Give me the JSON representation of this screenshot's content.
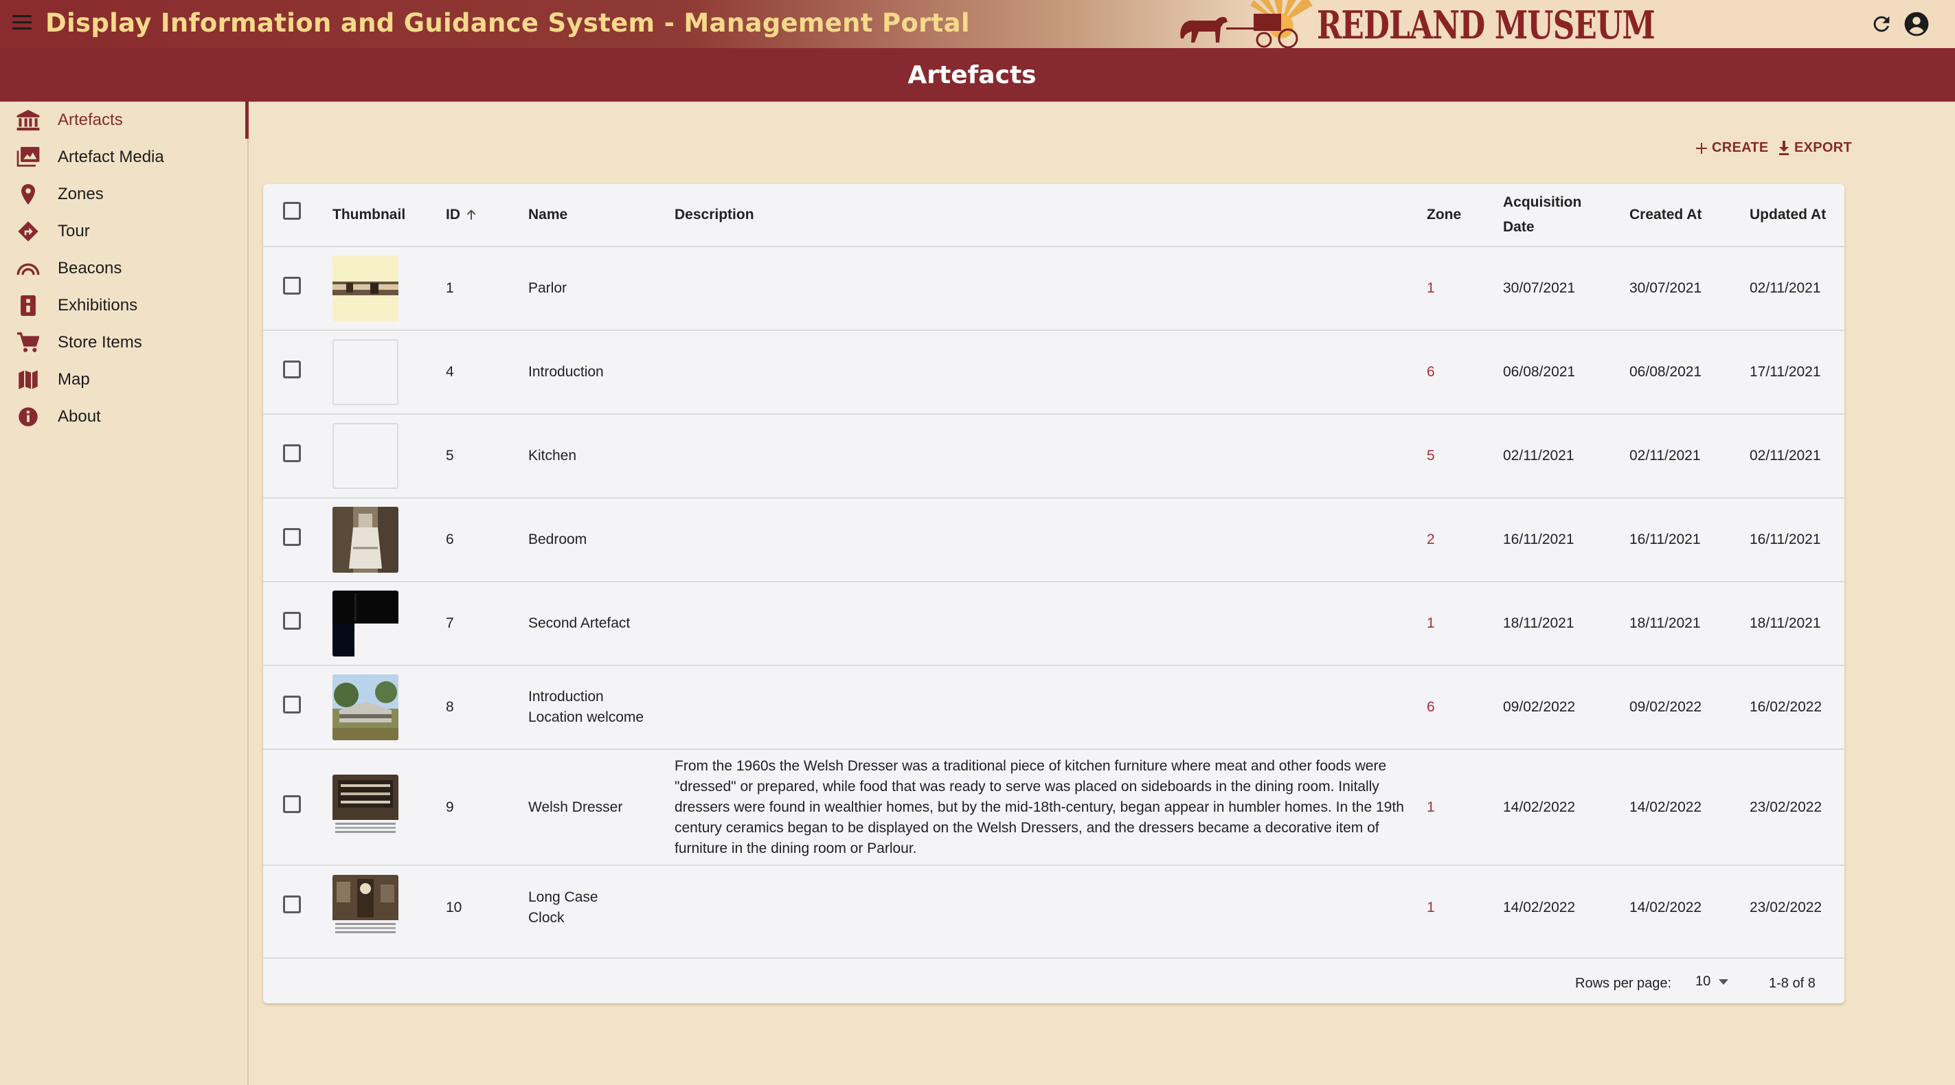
{
  "app": {
    "title": "Display Information and Guidance System - Management Portal",
    "logo_text": "REDLAND MUSEUM",
    "brand_color": "#872a2f"
  },
  "page": {
    "title": "Artefacts"
  },
  "sidebar": {
    "items": [
      {
        "label": "Artefacts",
        "icon": "museum-icon",
        "active": true
      },
      {
        "label": "Artefact Media",
        "icon": "image-gallery-icon"
      },
      {
        "label": "Zones",
        "icon": "location-pin-icon"
      },
      {
        "label": "Tour",
        "icon": "directions-icon"
      },
      {
        "label": "Beacons",
        "icon": "beacon-signal-icon"
      },
      {
        "label": "Exhibitions",
        "icon": "exhibition-icon"
      },
      {
        "label": "Store Items",
        "icon": "shopping-cart-icon"
      },
      {
        "label": "Map",
        "icon": "map-icon"
      },
      {
        "label": "About",
        "icon": "info-icon"
      }
    ]
  },
  "toolbar": {
    "create_label": "CREATE",
    "export_label": "EXPORT"
  },
  "table": {
    "headers": {
      "thumbnail": "Thumbnail",
      "id": "ID",
      "name": "Name",
      "description": "Description",
      "zone": "Zone",
      "acquisition_date_1": "Acquisition",
      "acquisition_date_2": "Date",
      "created_at": "Created At",
      "updated_at": "Updated At"
    },
    "rows": [
      {
        "id": "1",
        "name": "Parlor",
        "description": "",
        "zone": "1",
        "acquisition": "30/07/2021",
        "created": "30/07/2021",
        "updated": "02/11/2021",
        "thumb": "parlor"
      },
      {
        "id": "4",
        "name": "Introduction",
        "description": "",
        "zone": "6",
        "acquisition": "06/08/2021",
        "created": "06/08/2021",
        "updated": "17/11/2021",
        "thumb": "empty"
      },
      {
        "id": "5",
        "name": "Kitchen",
        "description": "",
        "zone": "5",
        "acquisition": "02/11/2021",
        "created": "02/11/2021",
        "updated": "02/11/2021",
        "thumb": "empty"
      },
      {
        "id": "6",
        "name": "Bedroom",
        "description": "",
        "zone": "2",
        "acquisition": "16/11/2021",
        "created": "16/11/2021",
        "updated": "16/11/2021",
        "thumb": "bedroom"
      },
      {
        "id": "7",
        "name": "Second Artefact",
        "description": "",
        "zone": "1",
        "acquisition": "18/11/2021",
        "created": "18/11/2021",
        "updated": "18/11/2021",
        "thumb": "dark"
      },
      {
        "id": "8",
        "name": "Introduction Location welcome",
        "description": "",
        "zone": "6",
        "acquisition": "09/02/2022",
        "created": "09/02/2022",
        "updated": "16/02/2022",
        "thumb": "building"
      },
      {
        "id": "9",
        "name": "Welsh Dresser",
        "description": "From the 1960s the Welsh Dresser was a traditional piece of kitchen furniture where meat and other foods were \"dressed\" or prepared, while food that was ready to serve was placed on sideboards in the dining room. Initally dressers were found in wealthier homes, but by the mid-18th-century, began appear in humbler homes. In the 19th century ceramics began to be displayed on the Welsh Dressers, and the dressers became a decorative item of furniture in the dining room or Parlour.",
        "zone": "1",
        "acquisition": "14/02/2022",
        "created": "14/02/2022",
        "updated": "23/02/2022",
        "thumb": "dresser"
      },
      {
        "id": "10",
        "name": "Long Case Clock",
        "description": "",
        "zone": "1",
        "acquisition": "14/02/2022",
        "created": "14/02/2022",
        "updated": "23/02/2022",
        "thumb": "clock"
      }
    ]
  },
  "pagination": {
    "rows_per_page_label": "Rows per page:",
    "rows_per_page": "10",
    "range": "1-8 of 8"
  }
}
